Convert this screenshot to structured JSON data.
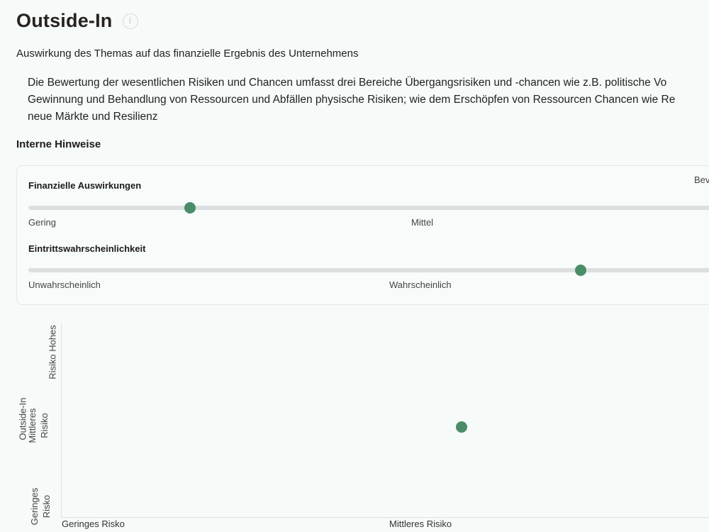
{
  "header": {
    "title": "Outside-In",
    "info_icon": "info-icon"
  },
  "subtitle": "Auswirkung des Themas auf das finanzielle Ergebnis des Unternehmens",
  "description": {
    "line1": "Die Bewertung der wesentlichen Risiken und Chancen umfasst drei Bereiche Übergangsrisiken und -chancen wie z.B. politische Vo",
    "line2": "Gewinnung und Behandlung von Ressourcen und Abfällen physische Risiken; wie dem Erschöpfen von Ressourcen Chancen wie Re",
    "line3": "neue Märkte und Resilienz"
  },
  "notes_heading": "Interne Hinweise",
  "card": {
    "corner_text": "Bev",
    "financial": {
      "label": "Finanzielle Auswirkungen",
      "value_fraction": 0.23,
      "ticks": [
        "Gering",
        "Mittel"
      ]
    },
    "probability": {
      "label": "Eintrittswahrscheinlichkeit",
      "value_fraction": 0.787,
      "ticks": [
        "Unwahrscheinlich",
        "Wahrscheinlich"
      ]
    }
  },
  "matrix": {
    "y_title": "Outside-In",
    "y_ticks": {
      "high": "Risiko Hohes",
      "mid_top": "Mittleres",
      "mid_bottom": "Risiko",
      "low_top": "Geringes",
      "low_bottom": "Risko"
    },
    "x_ticks": [
      "Geringes Risko",
      "Mittleres Risiko"
    ],
    "point": {
      "x_fraction": 0.618,
      "y_fraction": 0.535
    }
  },
  "colors": {
    "accent": "#4a8c68",
    "track": "#dcdfe0",
    "background": "#f6faf8"
  }
}
